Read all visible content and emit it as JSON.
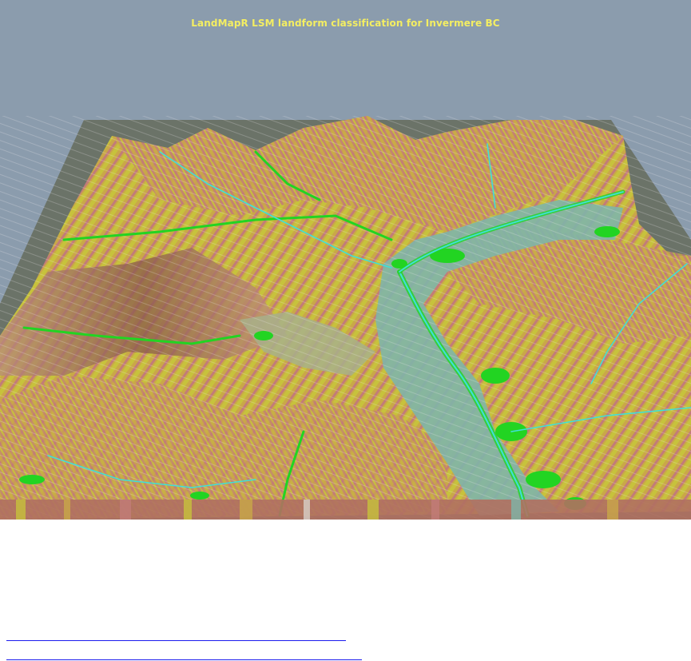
{
  "title": "LandMapR LSM landform classification for Invermere BC",
  "colors": {
    "sky": "#8b9cad",
    "base_plate": "#6b7368",
    "title_text": "#f4ee62",
    "class_upper_slope": "#c27c78",
    "class_mid_slope": "#c9a848",
    "class_backslope": "#c7c23c",
    "class_toe": "#a8b08a",
    "class_depression": "#22d422",
    "class_lower": "#7fb5a8",
    "channels": "#3fe0d8",
    "contours": "#f2eef0",
    "links": "#1a1aee"
  },
  "links": [
    {
      "name": "link-1",
      "text": ""
    },
    {
      "name": "link-2",
      "text": ""
    }
  ]
}
